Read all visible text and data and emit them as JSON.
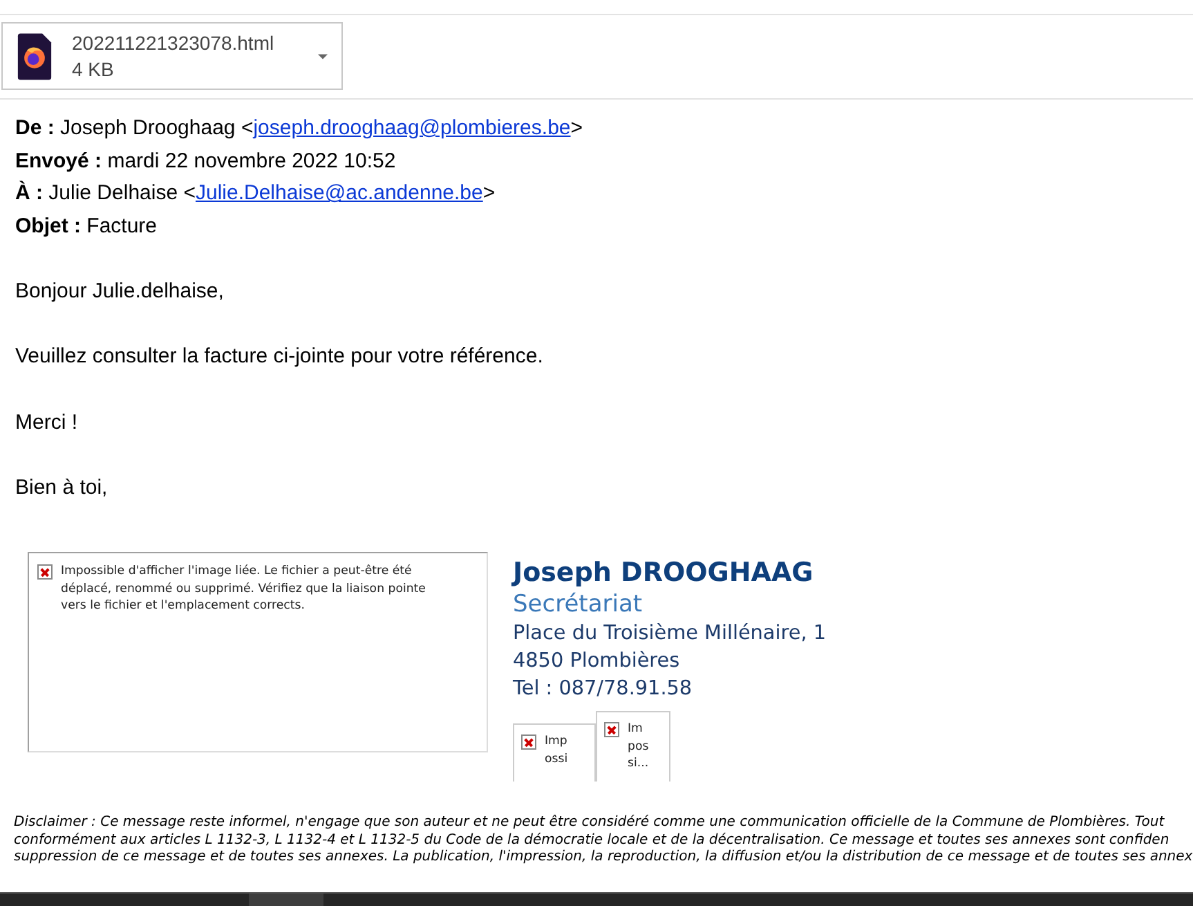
{
  "download": {
    "filename": "202211221323078.html",
    "size": "4 KB"
  },
  "headers": [
    {
      "label": "De :",
      "name": "Joseph Drooghaag <",
      "email": "joseph.drooghaag@plombieres.be",
      "close": ">"
    },
    {
      "label": "Envoyé :",
      "value": "mardi 22 novembre 2022 10:52"
    },
    {
      "label": "À :",
      "name": "Julie Delhaise <",
      "email": "Julie.Delhaise@ac.andenne.be",
      "close": ">"
    },
    {
      "label": "Objet :",
      "value": "Facture"
    }
  ],
  "body": [
    "Bonjour Julie.delhaise,",
    "Veuillez consulter la facture ci-jointe pour votre référence.",
    "Merci !",
    "Bien à toi,"
  ],
  "signature": {
    "broken_image": "Impossible d'afficher l'image liée. Le fichier a peut-être été déplacé, renommé ou supprimé. Vérifiez que la liaison pointe vers le fichier et l'emplacement corrects.",
    "name": "Joseph DROOGHAAG",
    "department": "Secrétariat",
    "address": [
      "Place du Troisième Millénaire, 1",
      "4850 Plombières",
      "Tel : 087/78.91.58"
    ],
    "small_images": [
      "Imp ossi",
      "Im pos si..."
    ]
  },
  "disclaimer": [
    "Disclaimer : Ce message reste informel, n'engage que son auteur et ne peut être considéré comme une communication officielle de la Commune de Plombières. Tout",
    "conformément aux articles L 1132-3, L 1132-4 et L 1132-5 du Code de la démocratie locale et de la décentralisation. Ce message et toutes ses annexes sont confiden",
    "suppression de ce message et de toutes ses annexes. La publication, l'impression, la reproduction, la diffusion et/ou la distribution de ce message et de toutes ses annex"
  ]
}
